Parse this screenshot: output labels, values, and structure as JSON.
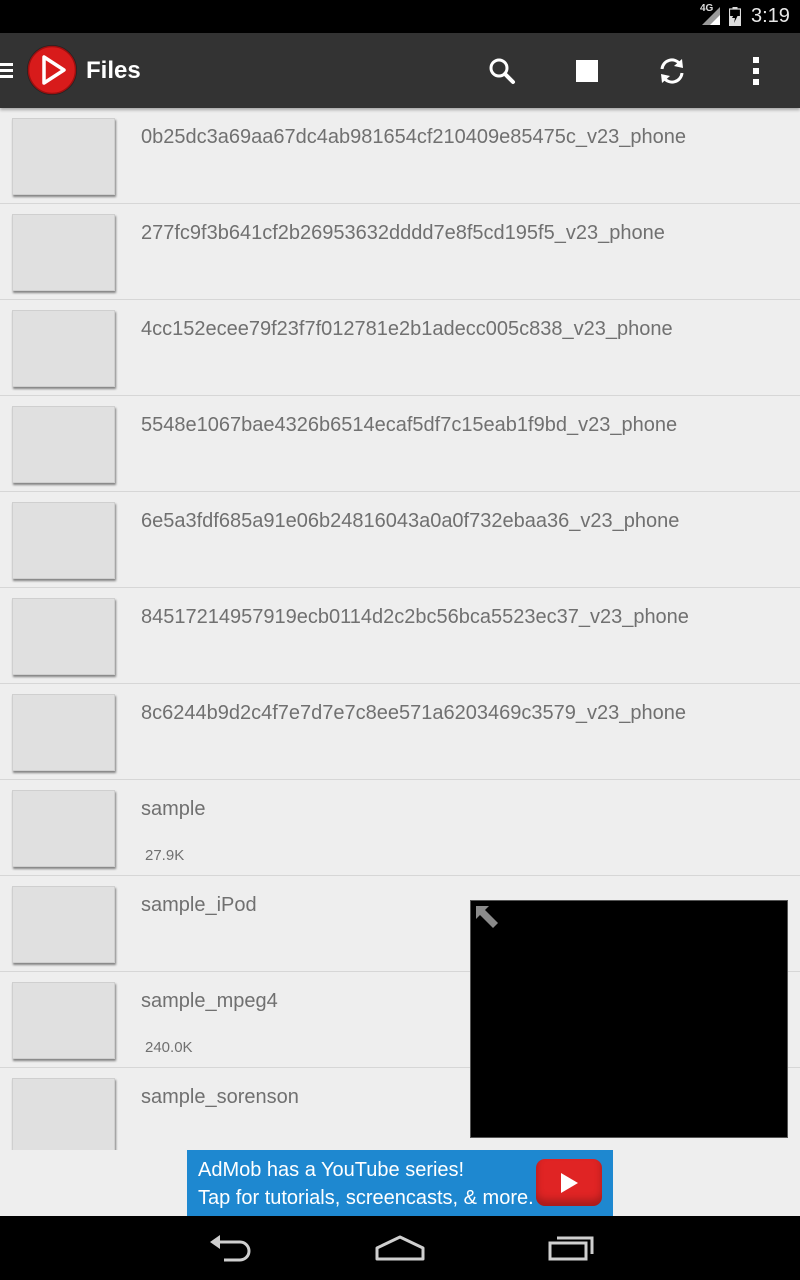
{
  "status_bar": {
    "network": "4G",
    "time": "3:19"
  },
  "action_bar": {
    "title": "Files",
    "icons": [
      "menu-icon",
      "app-logo-play-icon",
      "search-icon",
      "stop-icon",
      "refresh-icon",
      "overflow-menu-icon"
    ]
  },
  "files": [
    {
      "name": "0b25dc3a69aa67dc4ab981654cf210409e85475c_v23_phone",
      "size": ""
    },
    {
      "name": "277fc9f3b641cf2b26953632dddd7e8f5cd195f5_v23_phone",
      "size": ""
    },
    {
      "name": "4cc152ecee79f23f7f012781e2b1adecc005c838_v23_phone",
      "size": ""
    },
    {
      "name": "5548e1067bae4326b6514ecaf5df7c15eab1f9bd_v23_phone",
      "size": ""
    },
    {
      "name": "6e5a3fdf685a91e06b24816043a0a0f732ebaa36_v23_phone",
      "size": ""
    },
    {
      "name": "84517214957919ecb0114d2c2bc56bca5523ec37_v23_phone",
      "size": ""
    },
    {
      "name": "8c6244b9d2c4f7e7d7e7c8ee571a6203469c3579_v23_phone",
      "size": ""
    },
    {
      "name": "sample",
      "size": "27.9K"
    },
    {
      "name": "sample_iPod",
      "size": ""
    },
    {
      "name": "sample_mpeg4",
      "size": "240.0K"
    },
    {
      "name": "sample_sorenson",
      "size": ""
    }
  ],
  "ad": {
    "line1": "AdMob has a YouTube series!",
    "line2": "Tap for tutorials, screencasts, & more.",
    "icon": "youtube-play-icon"
  },
  "nav_bar": {
    "icons": [
      "back-icon",
      "home-icon",
      "recents-icon"
    ]
  },
  "colors": {
    "action_bar": "#333333",
    "list_bg": "#eeeeee",
    "ad_bg": "#1e88d0",
    "logo_red": "#d81b1b"
  }
}
